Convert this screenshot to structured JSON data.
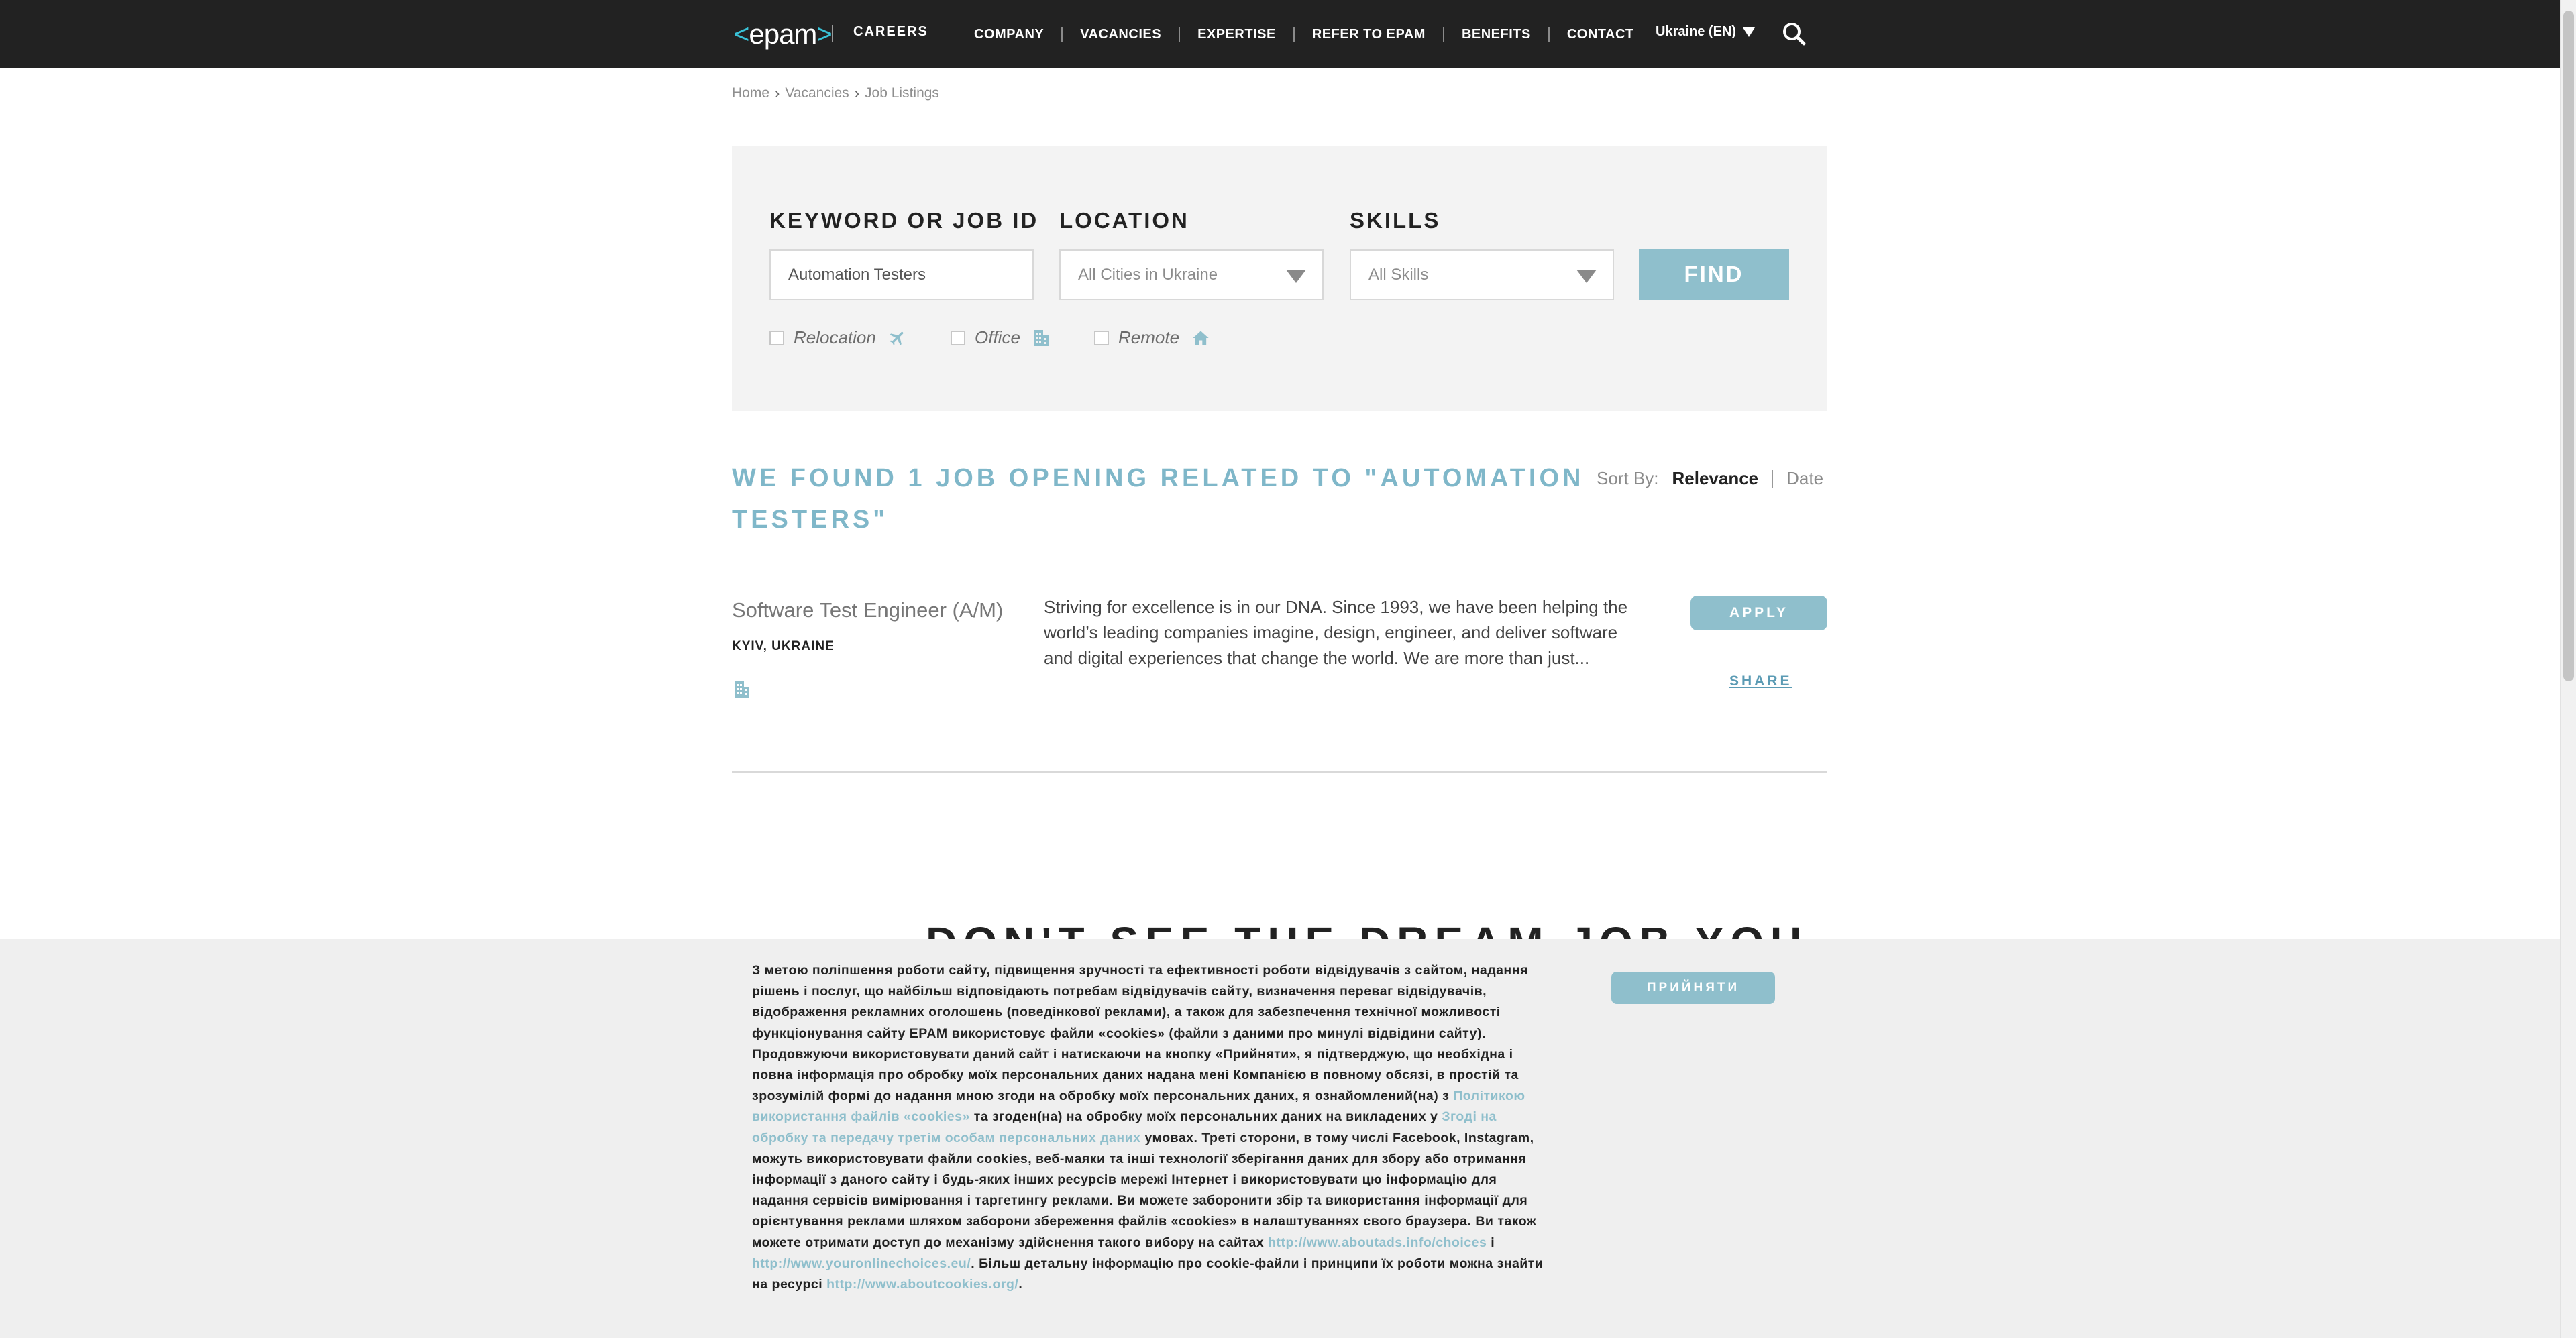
{
  "header": {
    "logo_text": "epam",
    "careers": "CAREERS",
    "nav": [
      "COMPANY",
      "VACANCIES",
      "EXPERTISE",
      "REFER TO EPAM",
      "BENEFITS",
      "CONTACT"
    ],
    "language": "Ukraine (EN)",
    "search_icon": "search-icon"
  },
  "breadcrumb": [
    "Home",
    "Vacancies",
    "Job Listings"
  ],
  "search": {
    "keyword_label": "KEYWORD OR JOB ID",
    "keyword_value": "Automation Testers",
    "location_label": "LOCATION",
    "location_value": "All Cities in Ukraine",
    "skills_label": "SKILLS",
    "skills_value": "All Skills",
    "find_label": "FIND",
    "filters": [
      {
        "label": "Relocation",
        "icon": "airplane-icon",
        "checked": false
      },
      {
        "label": "Office",
        "icon": "office-building-icon",
        "checked": false
      },
      {
        "label": "Remote",
        "icon": "home-icon",
        "checked": false
      }
    ]
  },
  "results": {
    "title": "WE FOUND 1 JOB OPENING RELATED TO \"AUTOMATION TESTERS\"",
    "sort_label": "Sort By:",
    "sort_active": "Relevance",
    "sort_other": "Date"
  },
  "job": {
    "title": "Software Test Engineer (A/M)",
    "location": "KYIV, UKRAINE",
    "description": "Striving for excellence is in our DNA. Since 1993, we have been helping the world’s leading companies imagine, design, engineer, and deliver software and digital experiences that change the world. We are more than just...",
    "apply_label": "APPLY",
    "share_label": "SHARE"
  },
  "dream_heading": "DON'T SEE THE DREAM JOB YOU",
  "cookie": {
    "text_1": "З метою поліпшення роботи сайту, підвищення зручності та ефективності роботи відвідувачів з сайтом, надання рішень і послуг, що найбільш відповідають потребам відвідувачів сайту, визначення переваг відвідувачів, відображення рекламних оголошень (поведінкової реклами), а також для забезпечення технічної можливості функціонування сайту EPAM використовує файли «cookies» (файли з даними про минулі відвідини сайту). Продовжуючи використовувати даний сайт і натискаючи на кнопку «Прийняти», я підтверджую, що необхідна і повна інформація про обробку моїх персональних даних надана мені Компанією в повному обсязі, в простій та зрозумілій формі до надання мною згоди на обробку моїх персональних даних, я ознайомлений(на) з",
    "link_1": "Політикою використання файлів «cookies»",
    "text_2": "та згоден(на) на обробку моїх персональних даних на викладених у",
    "link_2": "Згоді на обробку та передачу третім особам персональних даних",
    "text_3": "умовах. Треті сторони, в тому числі Facebook, Instagram, можуть використовувати файли cookies, веб-маяки та інші технології зберігання даних для збору або отримання інформації з даного сайту і будь-яких інших ресурсів мережі Інтернет і використовувати цю інформацію для надання сервісів вимірювання і таргетингу реклами. Ви можете заборонити збір та використання інформації для орієнтування реклами шляхом заборони збереження файлів «cookies» в налаштуваннях свого браузера. Ви також можете отримати доступ до механізму здійснення такого вибору на сайтах",
    "link_3": "http://www.aboutads.info/choices",
    "text_4": "і",
    "link_4": "http://www.youronlinechoices.eu/",
    "text_5": ". Більш детальну інформацію про cookie-файли і принципи їх роботи можна знайти на ресурсі",
    "link_5": "http://www.aboutcookies.org/",
    "text_6": ".",
    "accept_label": "ПРИЙНЯТИ"
  },
  "colors": {
    "header_bg": "#222222",
    "accent": "#8fbfcc",
    "title_blue": "#7fb7c9",
    "panel_bg": "#f3f3f3"
  }
}
